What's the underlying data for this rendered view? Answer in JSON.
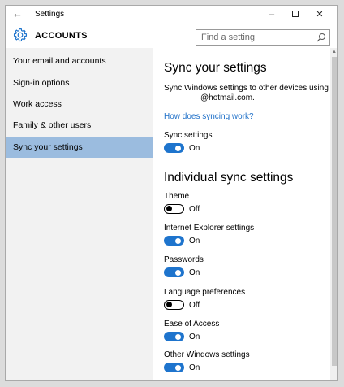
{
  "window": {
    "title": "Settings"
  },
  "titlebar": {
    "back_glyph": "←",
    "min_glyph": "–",
    "close_glyph": "✕"
  },
  "header": {
    "section": "ACCOUNTS",
    "search_placeholder": "Find a setting"
  },
  "sidebar": {
    "items": [
      {
        "label": "Your email and accounts",
        "selected": false
      },
      {
        "label": "Sign-in options",
        "selected": false
      },
      {
        "label": "Work access",
        "selected": false
      },
      {
        "label": "Family & other users",
        "selected": false
      },
      {
        "label": "Sync your settings",
        "selected": true
      }
    ]
  },
  "main": {
    "title": "Sync your settings",
    "description_line1": "Sync Windows settings to other devices using",
    "description_line2": "@hotmail.com.",
    "help_link": "How does syncing work?",
    "sync_settings": {
      "label": "Sync settings",
      "state": "On"
    },
    "individual_title": "Individual sync settings",
    "individual": [
      {
        "label": "Theme",
        "state": "Off"
      },
      {
        "label": "Internet Explorer settings",
        "state": "On"
      },
      {
        "label": "Passwords",
        "state": "On"
      },
      {
        "label": "Language preferences",
        "state": "Off"
      },
      {
        "label": "Ease of Access",
        "state": "On"
      },
      {
        "label": "Other Windows settings",
        "state": "On"
      }
    ]
  },
  "colors": {
    "accent": "#1e74cd",
    "selected_nav": "#9bbcdf",
    "link": "#1a6dc7",
    "sidebar_bg": "#f2f2f2"
  }
}
